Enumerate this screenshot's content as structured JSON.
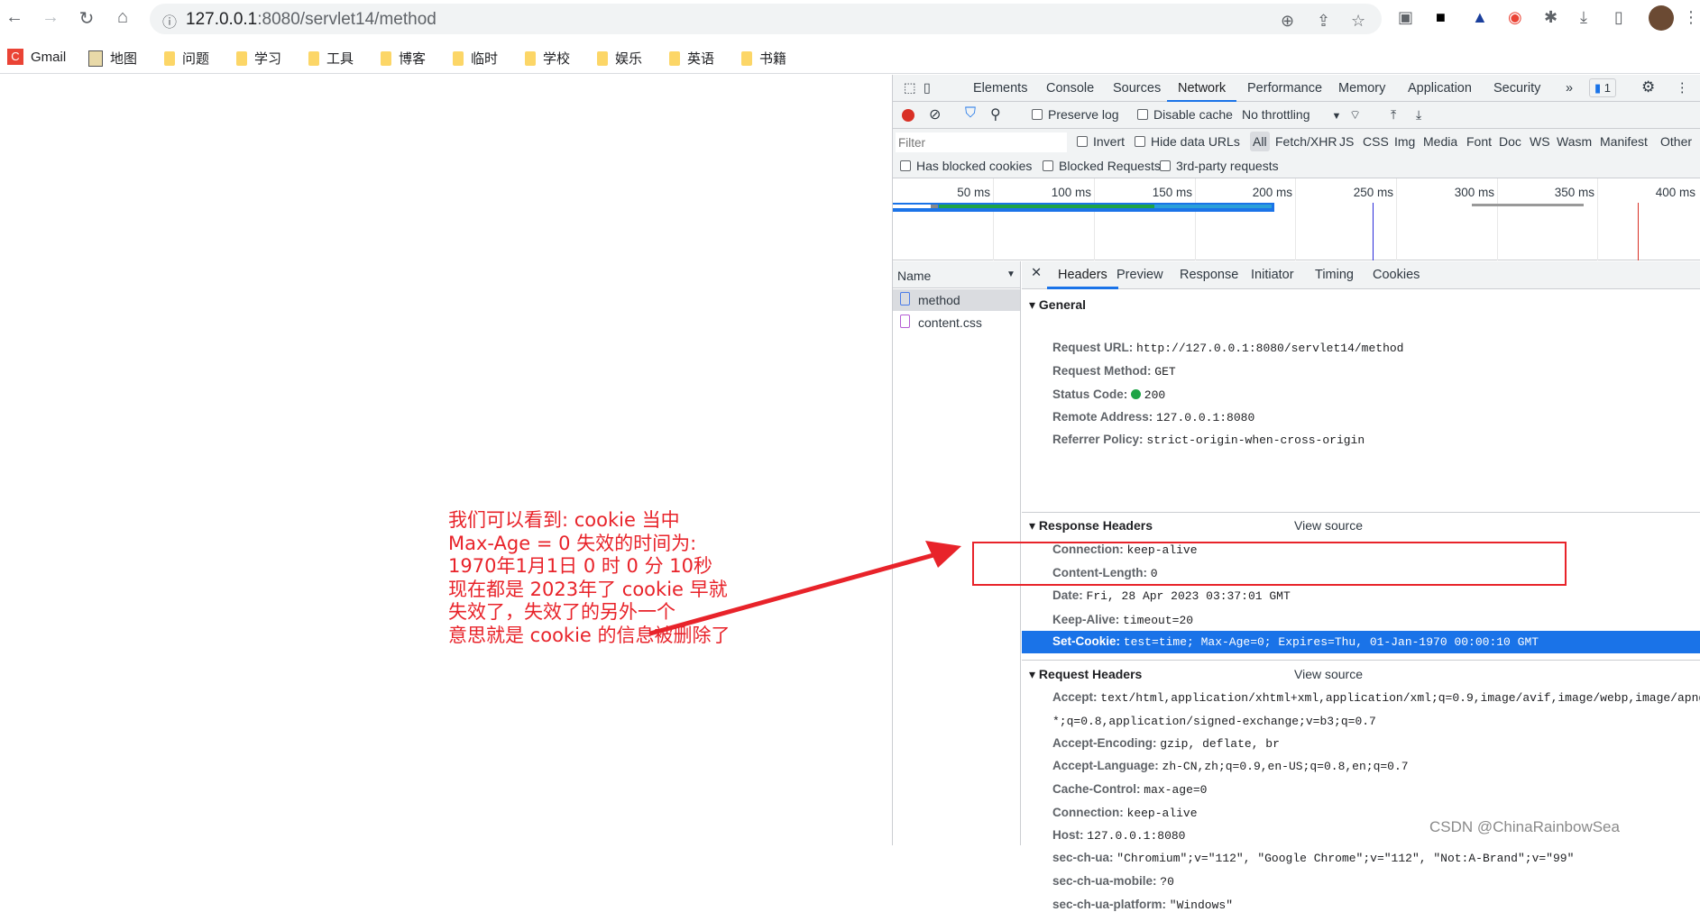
{
  "browser": {
    "url_host": "127.0.0.1",
    "url_rest": ":8080/servlet14/method",
    "nav_icons": [
      "back-icon",
      "forward-icon",
      "reload-icon",
      "home-icon"
    ],
    "bookmarks": [
      {
        "label": "Gmail",
        "icon": "gmail-icon"
      },
      {
        "label": "地图",
        "icon": "maps-icon"
      },
      {
        "label": "问题",
        "icon": "folder-icon"
      },
      {
        "label": "学习",
        "icon": "folder-icon"
      },
      {
        "label": "工具",
        "icon": "folder-icon"
      },
      {
        "label": "博客",
        "icon": "folder-icon"
      },
      {
        "label": "临时",
        "icon": "folder-icon"
      },
      {
        "label": "学校",
        "icon": "folder-icon"
      },
      {
        "label": "娱乐",
        "icon": "folder-icon"
      },
      {
        "label": "英语",
        "icon": "folder-icon"
      },
      {
        "label": "书籍",
        "icon": "folder-icon"
      }
    ]
  },
  "devtools": {
    "tabs": [
      "Elements",
      "Console",
      "Sources",
      "Network",
      "Performance",
      "Memory",
      "Application",
      "Security"
    ],
    "active_tab": "Network",
    "issues_count": "1",
    "toolbar": {
      "preserve_log": "Preserve log",
      "disable_cache": "Disable cache",
      "throttling": "No throttling"
    },
    "filter": {
      "placeholder": "Filter",
      "invert": "Invert",
      "hide_data_urls": "Hide data URLs",
      "types": [
        "All",
        "Fetch/XHR",
        "JS",
        "CSS",
        "Img",
        "Media",
        "Font",
        "Doc",
        "WS",
        "Wasm",
        "Manifest",
        "Other"
      ],
      "blocked_cookies": "Has blocked cookies",
      "blocked_requests": "Blocked Requests",
      "third_party": "3rd-party requests"
    },
    "timeline_ticks": [
      "50 ms",
      "100 ms",
      "150 ms",
      "200 ms",
      "250 ms",
      "300 ms",
      "350 ms",
      "400 ms"
    ],
    "name_header": "Name",
    "requests": [
      {
        "name": "method",
        "icon": "document-icon"
      },
      {
        "name": "content.css",
        "icon": "stylesheet-icon"
      }
    ],
    "detail_tabs": [
      "Headers",
      "Preview",
      "Response",
      "Initiator",
      "Timing",
      "Cookies"
    ],
    "general": {
      "title": "General",
      "rows": [
        {
          "k": "Request URL:",
          "v": "http://127.0.0.1:8080/servlet14/method"
        },
        {
          "k": "Request Method:",
          "v": "GET"
        },
        {
          "k": "Status Code:",
          "v": "200"
        },
        {
          "k": "Remote Address:",
          "v": "127.0.0.1:8080"
        },
        {
          "k": "Referrer Policy:",
          "v": "strict-origin-when-cross-origin"
        }
      ]
    },
    "view_source": "View source",
    "response_headers": {
      "title": "Response Headers",
      "rows": [
        {
          "k": "Connection:",
          "v": "keep-alive"
        },
        {
          "k": "Content-Length:",
          "v": "0"
        },
        {
          "k": "Date:",
          "v": "Fri, 28 Apr 2023 03:37:01 GMT"
        },
        {
          "k": "Keep-Alive:",
          "v": "timeout=20"
        },
        {
          "k": "Set-Cookie:",
          "v": "test=time; Max-Age=0; Expires=Thu, 01-Jan-1970 00:00:10 GMT"
        }
      ]
    },
    "request_headers": {
      "title": "Request Headers",
      "rows": [
        {
          "k": "Accept:",
          "v": "text/html,application/xhtml+xml,application/xml;q=0.9,image/avif,image/webp,image/apng,*/"
        },
        {
          "k": "",
          "v": "*;q=0.8,application/signed-exchange;v=b3;q=0.7"
        },
        {
          "k": "Accept-Encoding:",
          "v": "gzip, deflate, br"
        },
        {
          "k": "Accept-Language:",
          "v": "zh-CN,zh;q=0.9,en-US;q=0.8,en;q=0.7"
        },
        {
          "k": "Cache-Control:",
          "v": "max-age=0"
        },
        {
          "k": "Connection:",
          "v": "keep-alive"
        },
        {
          "k": "Host:",
          "v": "127.0.0.1:8080"
        },
        {
          "k": "sec-ch-ua:",
          "v": "\"Chromium\";v=\"112\", \"Google Chrome\";v=\"112\", \"Not:A-Brand\";v=\"99\""
        },
        {
          "k": "sec-ch-ua-mobile:",
          "v": "?0"
        },
        {
          "k": "sec-ch-ua-platform:",
          "v": "\"Windows\""
        }
      ]
    },
    "colors": {
      "accent": "#1a73e8",
      "highlight": "#1a73e8",
      "status_ok": "#1ea446",
      "record": "#d93025"
    }
  },
  "annotation": {
    "text": "我们可以看到: cookie 当中\nMax-Age = 0 失效的时间为:\n1970年1月1日 0 时 0 分 10秒\n现在都是 2023年了 cookie 早就\n失效了，失效了的另外一个\n意思就是 cookie 的信息被删除了",
    "color": "#e8232a"
  },
  "watermark": "CSDN @ChinaRainbowSea"
}
